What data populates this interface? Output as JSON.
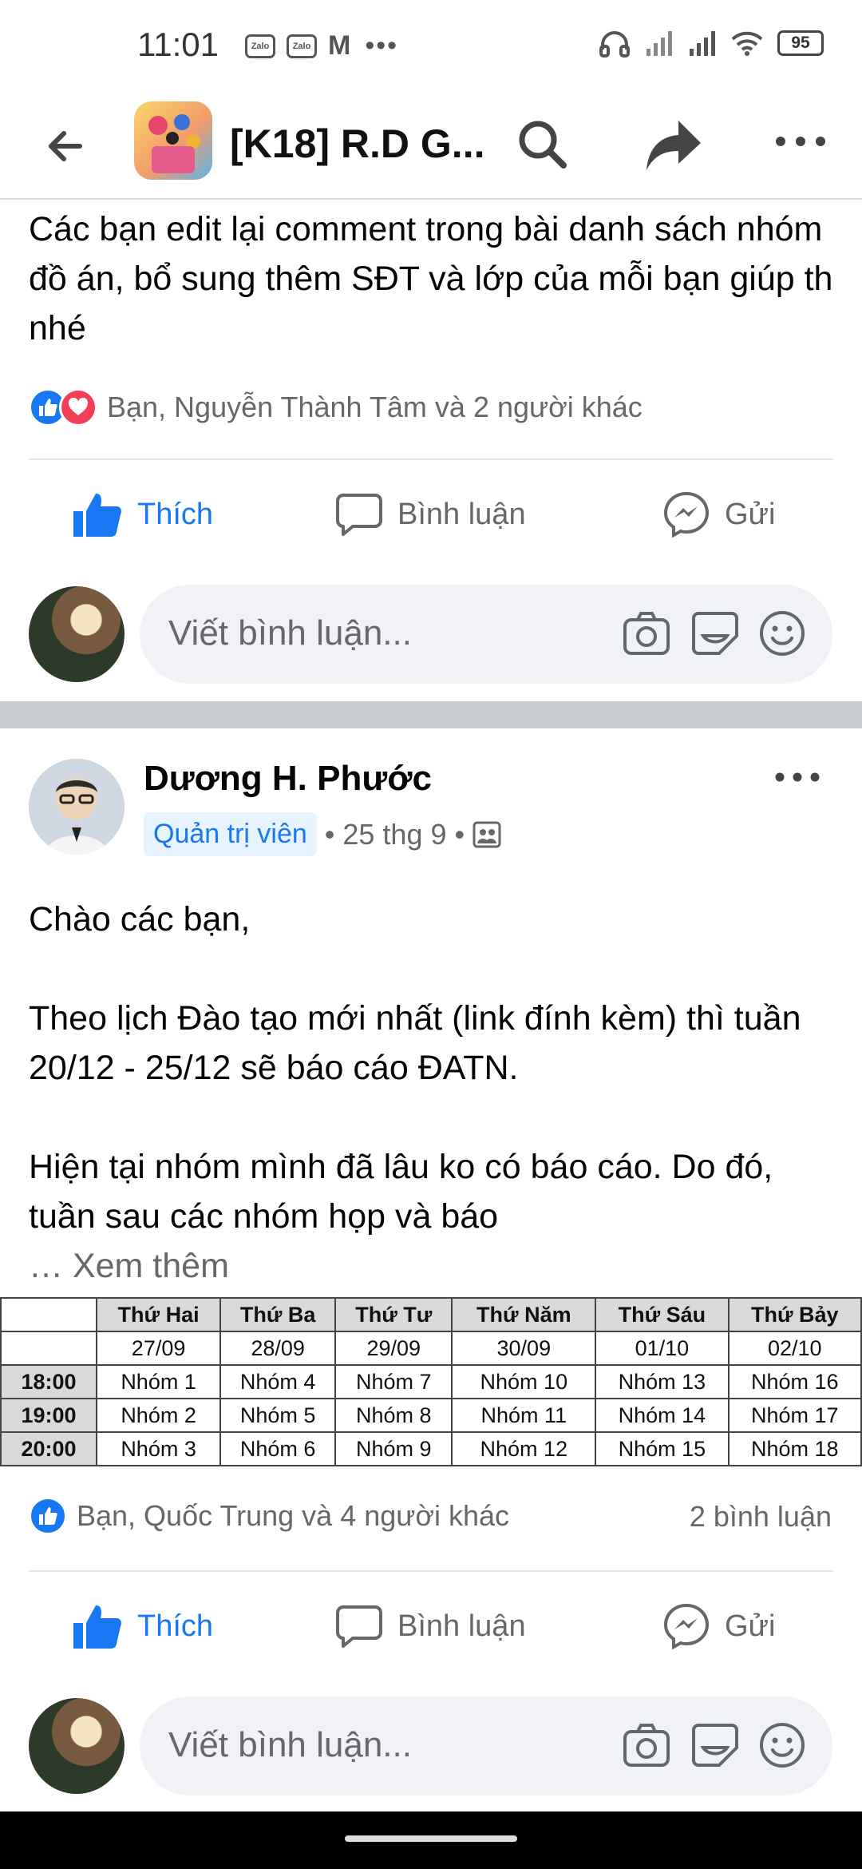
{
  "status_bar": {
    "time": "11:01",
    "left_icons": [
      "zalo-icon",
      "zalo-icon",
      "gmail-icon",
      "more-dots-icon"
    ],
    "zalo_label": "Zalo",
    "gmail_glyph": "M",
    "dots": "•••",
    "right_icons": [
      "headphones-icon",
      "signal-icon",
      "signal-icon",
      "wifi-icon",
      "battery-icon"
    ],
    "battery": "95"
  },
  "header": {
    "title": "[K18] R.D G...",
    "icons": [
      "back-arrow-icon",
      "search-icon",
      "share-icon",
      "more-icon"
    ]
  },
  "prev_post": {
    "text": "Các bạn edit lại comment trong bài danh sách nhóm đồ án, bổ sung thêm SĐT và lớp của mỗi bạn giúp th nhé",
    "reactions": "Bạn, Nguyễn Thành Tâm và 2 người khác"
  },
  "actions": {
    "like": "Thích",
    "comment": "Bình luận",
    "send": "Gửi"
  },
  "comment_box": {
    "placeholder": "Viết bình luận..."
  },
  "post": {
    "author": "Dương H. Phước",
    "role": "Quản trị viên",
    "date": "25 thg 9",
    "sep": "•",
    "paragraphs": [
      "Chào các bạn,",
      "Theo lịch Đào tạo mới nhất (link đính kèm) thì tuần 20/12 - 25/12 sẽ báo cáo ĐATN.",
      "Hiện tại nhóm mình đã lâu ko có báo cáo. Do đó, tuần sau các nhóm họp và báo"
    ],
    "see_more": "… Xem thêm",
    "schedule": {
      "days": [
        "Thứ Hai",
        "Thứ Ba",
        "Thứ Tư",
        "Thứ Năm",
        "Thứ Sáu",
        "Thứ Bảy"
      ],
      "dates": [
        "27/09",
        "28/09",
        "29/09",
        "30/09",
        "01/10",
        "02/10"
      ],
      "rows": [
        {
          "time": "18:00",
          "cells": [
            "Nhóm 1",
            "Nhóm 4",
            "Nhóm 7",
            "Nhóm 10",
            "Nhóm 13",
            "Nhóm 16"
          ]
        },
        {
          "time": "19:00",
          "cells": [
            "Nhóm 2",
            "Nhóm 5",
            "Nhóm 8",
            "Nhóm 11",
            "Nhóm 14",
            "Nhóm 17"
          ]
        },
        {
          "time": "20:00",
          "cells": [
            "Nhóm 3",
            "Nhóm 6",
            "Nhóm 9",
            "Nhóm 12",
            "Nhóm 15",
            "Nhóm 18"
          ]
        }
      ]
    },
    "reactions": "Bạn, Quốc Trung và 4 người khác",
    "comments_count": "2 bình luận"
  },
  "colors": {
    "accent": "#1877f2",
    "love": "#f33e58",
    "muted": "#65676b",
    "section_gap": "#c9ccd1"
  }
}
